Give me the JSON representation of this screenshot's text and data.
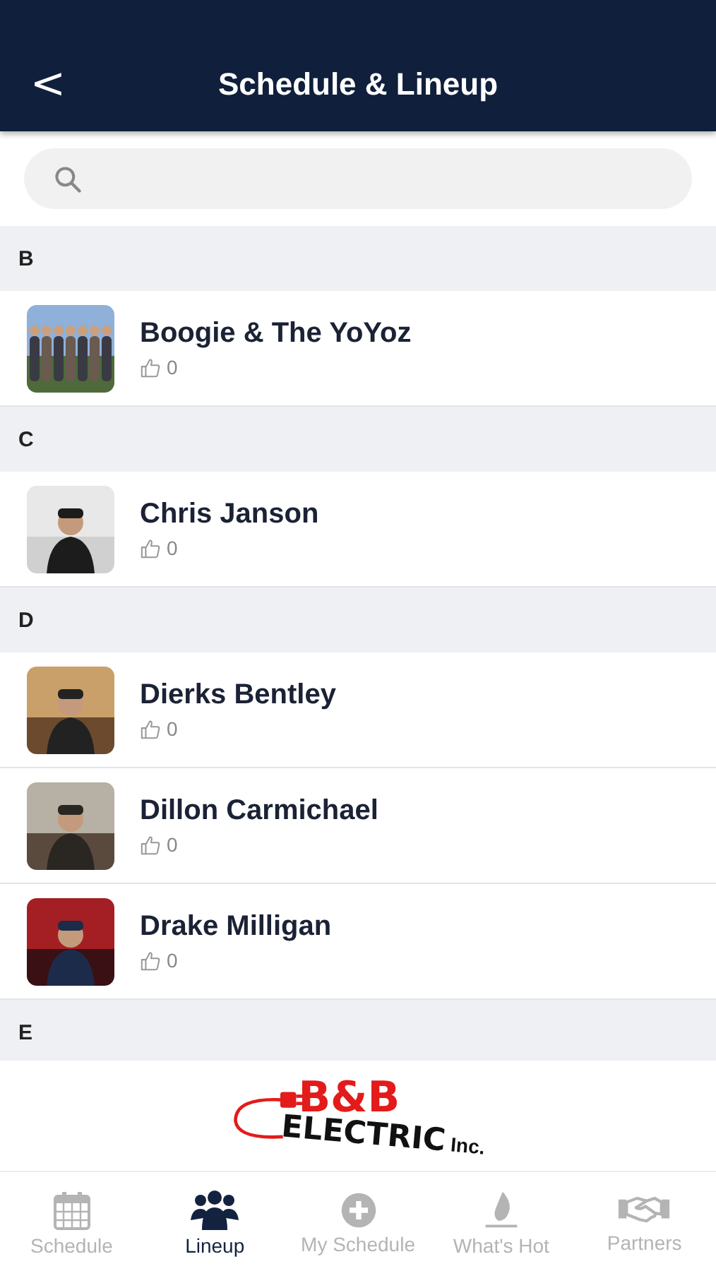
{
  "header": {
    "title": "Schedule & Lineup",
    "back": "<"
  },
  "sections": [
    {
      "letter": "B",
      "artists": [
        {
          "name": "Boogie & The YoYoz",
          "likes": "0"
        }
      ]
    },
    {
      "letter": "C",
      "artists": [
        {
          "name": "Chris Janson",
          "likes": "0"
        }
      ]
    },
    {
      "letter": "D",
      "artists": [
        {
          "name": "Dierks Bentley",
          "likes": "0"
        },
        {
          "name": "Dillon Carmichael",
          "likes": "0"
        },
        {
          "name": "Drake Milligan",
          "likes": "0"
        }
      ]
    },
    {
      "letter": "E"
    }
  ],
  "ad": {
    "top": "B&B",
    "main": "ELECTRIC",
    "suffix": "Inc."
  },
  "tabs": [
    {
      "label": "Schedule",
      "kind": "calendar",
      "selected": false
    },
    {
      "label": "Lineup",
      "kind": "people",
      "selected": true
    },
    {
      "label": "My Schedule",
      "kind": "plus",
      "selected": false
    },
    {
      "label": "What's Hot",
      "kind": "flame",
      "selected": false
    },
    {
      "label": "Partners",
      "kind": "handshake",
      "selected": false
    }
  ]
}
